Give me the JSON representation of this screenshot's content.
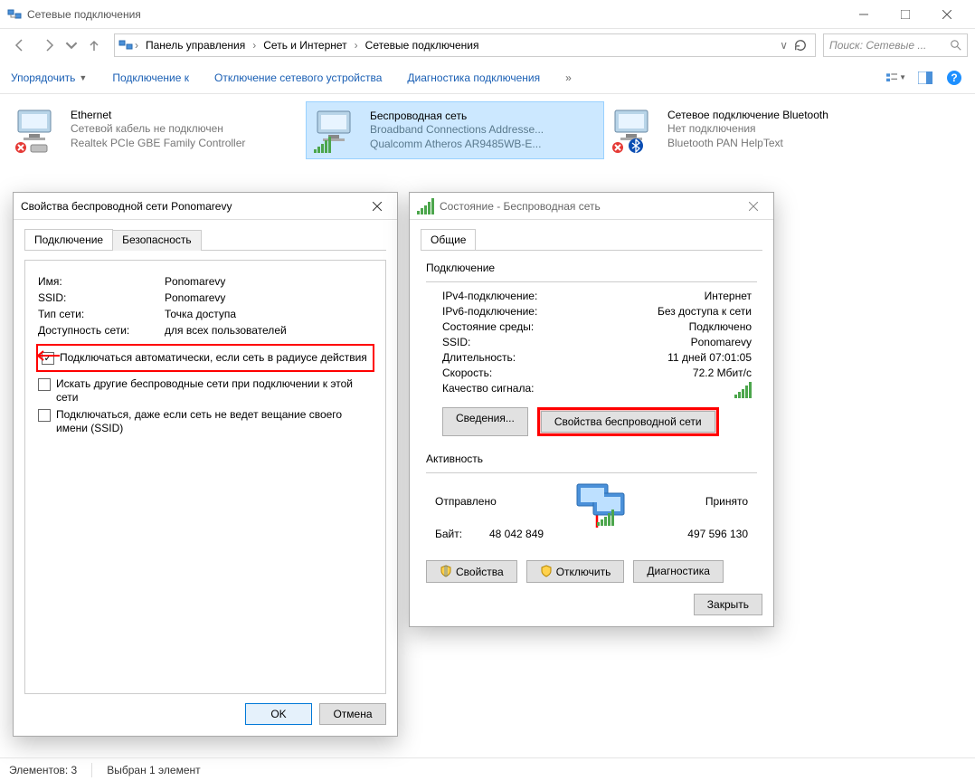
{
  "window": {
    "title": "Сетевые подключения",
    "searchPlaceholder": "Поиск: Сетевые ..."
  },
  "breadcrumb": {
    "items": [
      "Панель управления",
      "Сеть и Интернет",
      "Сетевые подключения"
    ]
  },
  "commandbar": {
    "organize": "Упорядочить",
    "connectTo": "Подключение к",
    "disableDevice": "Отключение сетевого устройства",
    "diagnose": "Диагностика подключения"
  },
  "connections": {
    "ethernet": {
      "title": "Ethernet",
      "line1": "Сетевой кабель не подключен",
      "line2": "Realtek PCIe GBE Family Controller"
    },
    "wireless": {
      "title": "Беспроводная сеть",
      "line1": "Broadband Connections Addresse...",
      "line2": "Qualcomm Atheros AR9485WB-E..."
    },
    "bluetooth": {
      "title": "Сетевое подключение Bluetooth",
      "line1": "Нет подключения",
      "line2": "Bluetooth PAN HelpText"
    }
  },
  "propsDialog": {
    "title": "Свойства беспроводной сети Ponomarevy",
    "tabs": {
      "connection": "Подключение",
      "security": "Безопасность"
    },
    "rows": {
      "nameLabel": "Имя:",
      "nameVal": "Ponomarevy",
      "ssidLabel": "SSID:",
      "ssidVal": "Ponomarevy",
      "typeLabel": "Тип сети:",
      "typeVal": "Точка доступа",
      "availLabel": "Доступность сети:",
      "availVal": "для всех пользователей"
    },
    "chk": {
      "auto": "Подключаться автоматически, если сеть в радиусе действия",
      "other": "Искать другие беспроводные сети при подключении к этой сети",
      "nossid": "Подключаться, даже если сеть не ведет вещание своего имени (SSID)"
    },
    "buttons": {
      "ok": "OK",
      "cancel": "Отмена"
    }
  },
  "statusDialog": {
    "title": "Состояние - Беспроводная сеть",
    "tab": "Общие",
    "groupConn": "Подключение",
    "rows": {
      "ipv4L": "IPv4-подключение:",
      "ipv4V": "Интернет",
      "ipv6L": "IPv6-подключение:",
      "ipv6V": "Без доступа к сети",
      "mediaL": "Состояние среды:",
      "mediaV": "Подключено",
      "ssidL": "SSID:",
      "ssidV": "Ponomarevy",
      "durL": "Длительность:",
      "durV": "11 дней 07:01:05",
      "speedL": "Скорость:",
      "speedV": "72.2 Мбит/с",
      "sigL": "Качество сигнала:"
    },
    "btns": {
      "details": "Сведения...",
      "wprops": "Свойства беспроводной сети"
    },
    "groupAct": "Активность",
    "act": {
      "sent": "Отправлено",
      "recv": "Принято",
      "bytesL": "Байт:",
      "bytesSent": "48 042 849",
      "bytesRecv": "497 596 130"
    },
    "btns2": {
      "props": "Свойства",
      "disable": "Отключить",
      "diag": "Диагностика"
    },
    "close": "Закрыть"
  },
  "statusbar": {
    "elements": "Элементов: 3",
    "selected": "Выбран 1 элемент"
  }
}
